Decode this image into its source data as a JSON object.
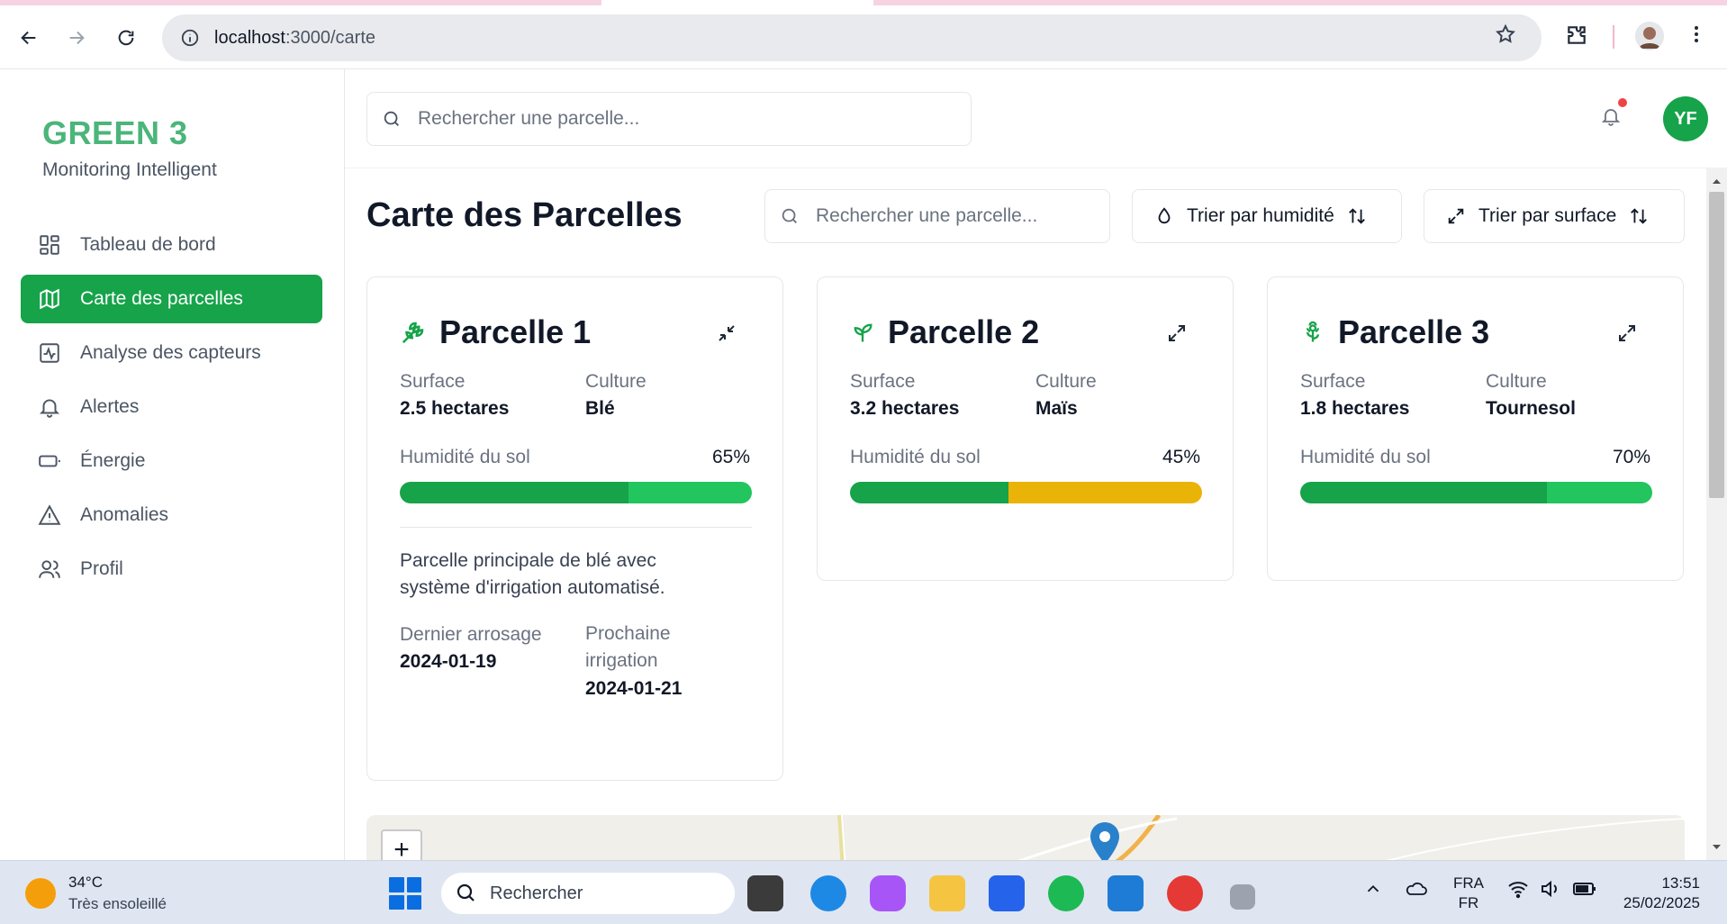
{
  "browser": {
    "url_host": "localhost",
    "url_path": ":3000/carte"
  },
  "sidebar": {
    "brand": "GREEN 3",
    "subtitle": "Monitoring Intelligent",
    "items": [
      {
        "label": "Tableau de bord",
        "icon": "dashboard-icon",
        "active": false
      },
      {
        "label": "Carte des parcelles",
        "icon": "map-icon",
        "active": true
      },
      {
        "label": "Analyse des capteurs",
        "icon": "activity-icon",
        "active": false
      },
      {
        "label": "Alertes",
        "icon": "bell-icon",
        "active": false
      },
      {
        "label": "Énergie",
        "icon": "battery-icon",
        "active": false
      },
      {
        "label": "Anomalies",
        "icon": "warning-icon",
        "active": false
      },
      {
        "label": "Profil",
        "icon": "users-icon",
        "active": false
      }
    ]
  },
  "header": {
    "search_placeholder": "Rechercher une parcelle...",
    "avatar_initials": "YF"
  },
  "main": {
    "title": "Carte des Parcelles",
    "filter_placeholder": "Rechercher une parcelle...",
    "sort_humidity": "Trier par humidité",
    "sort_surface": "Trier par surface",
    "labels": {
      "surface": "Surface",
      "culture": "Culture",
      "humidity": "Humidité du sol",
      "last_watering": "Dernier arrosage",
      "next_irrigation": "Prochaine irrigation"
    },
    "parcels": [
      {
        "name": "Parcelle 1",
        "surface": "2.5 hectares",
        "culture": "Blé",
        "humidity_text": "65%",
        "humidity": 0.65,
        "bar_color": "#22c55e",
        "expanded": true,
        "description": "Parcelle principale de blé avec système d'irrigation automatisé.",
        "last_watering": "2024-01-19",
        "next_irrigation": "2024-01-21"
      },
      {
        "name": "Parcelle 2",
        "surface": "3.2 hectares",
        "culture": "Maïs",
        "humidity_text": "45%",
        "humidity": 0.45,
        "bar_color": "#eab308",
        "expanded": false
      },
      {
        "name": "Parcelle 3",
        "surface": "1.8 hectares",
        "culture": "Tournesol",
        "humidity_text": "70%",
        "humidity": 0.7,
        "bar_color": "#22c55e",
        "expanded": false
      }
    ],
    "map_zoom_in": "+"
  },
  "colors": {
    "primary": "#16a34a",
    "brand": "#4bb57a",
    "warning": "#eab308"
  },
  "taskbar": {
    "temperature": "34°C",
    "weather": "Très ensoleillé",
    "search_placeholder": "Rechercher",
    "lang_1": "FRA",
    "lang_2": "FR",
    "time": "13:51",
    "date": "25/02/2025"
  }
}
